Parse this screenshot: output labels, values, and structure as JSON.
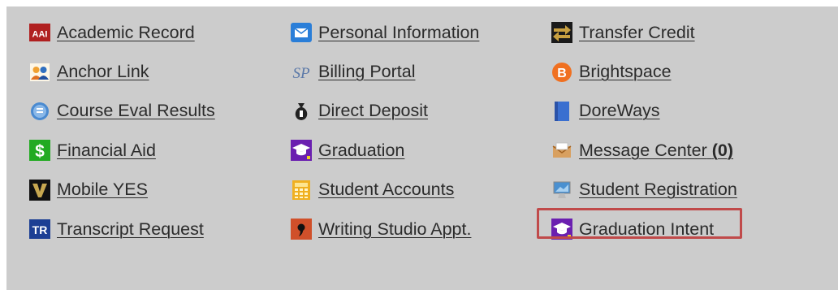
{
  "links": {
    "academic_record": "Academic Record",
    "personal_information": "Personal Information",
    "transfer_credit": "Transfer Credit",
    "anchor_link": "Anchor Link",
    "billing_portal": "Billing Portal",
    "brightspace": "Brightspace",
    "course_eval_results": "Course Eval Results",
    "direct_deposit": "Direct Deposit",
    "doreways": "DoreWays",
    "financial_aid": "Financial Aid",
    "graduation": "Graduation",
    "message_center": "Message Center",
    "message_center_count": "(0)",
    "mobile_yes": "Mobile YES",
    "student_accounts": "Student Accounts",
    "student_registration": "Student Registration",
    "transcript_request": "Transcript Request",
    "writing_studio_appt": "Writing Studio Appt.",
    "graduation_intent": "Graduation Intent"
  },
  "icon_text": {
    "academic_record": "AAI",
    "billing_portal": "SP",
    "financial_aid": "$",
    "transcript_request": "TR",
    "brightspace": "B"
  },
  "icons": {
    "academic_record": "aai-logo-icon",
    "personal_information": "envelope-icon",
    "transfer_credit": "transfer-arrows-icon",
    "anchor_link": "people-icon",
    "billing_portal": "sp-icon",
    "brightspace": "brightspace-icon",
    "course_eval_results": "evaluation-icon",
    "direct_deposit": "money-bag-icon",
    "doreways": "book-icon",
    "financial_aid": "dollar-icon",
    "graduation": "graduation-cap-icon",
    "message_center": "inbox-icon",
    "mobile_yes": "vanderbilt-v-icon",
    "student_accounts": "calculator-icon",
    "student_registration": "computer-icon",
    "transcript_request": "tr-icon",
    "writing_studio_appt": "quote-icon",
    "graduation_intent": "graduation-cap-icon"
  },
  "colors": {
    "panel_background": "#cccccc",
    "link_text": "#2b2b2b",
    "highlight_border": "#c04a4a"
  }
}
